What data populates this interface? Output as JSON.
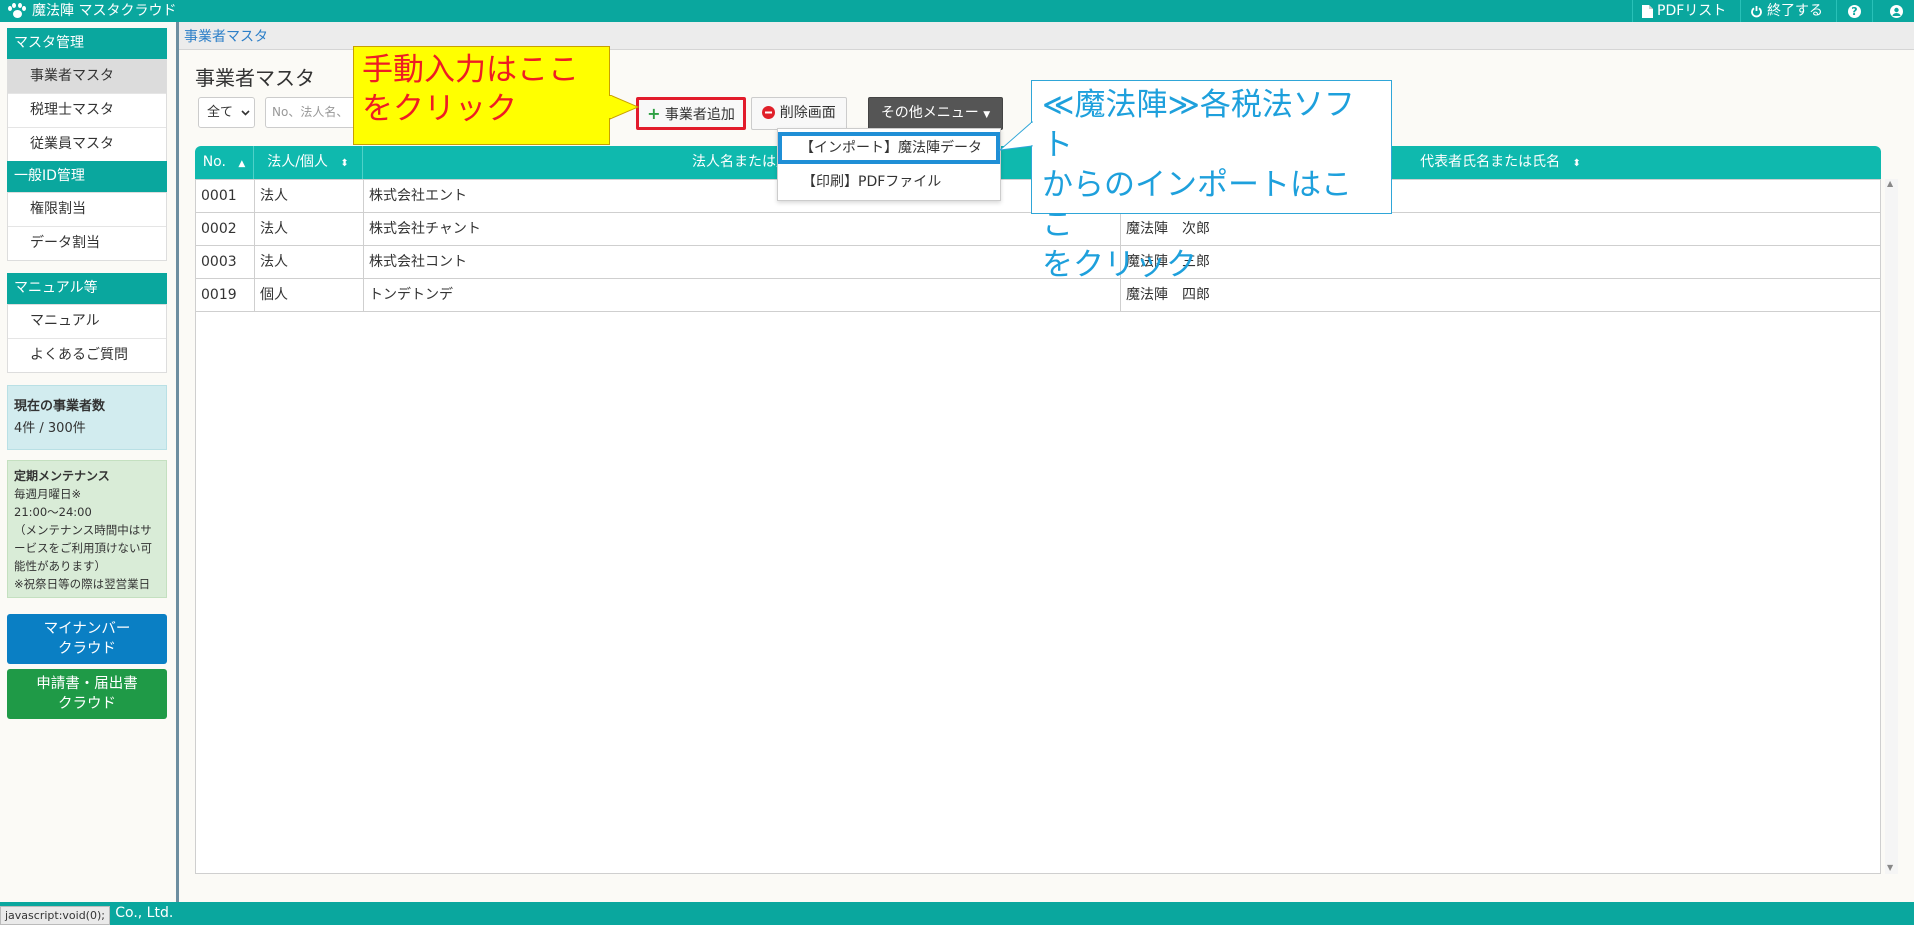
{
  "topbar": {
    "app_title": "魔法陣 マスタクラウド",
    "pdf_list": "PDFリスト",
    "logout": "終了する",
    "help_glyph": "?",
    "icons": [
      "paw-icon",
      "pdf-icon",
      "power-icon",
      "help-icon",
      "user-icon"
    ]
  },
  "sidebar": {
    "master_header": "マスタ管理",
    "master_items": [
      "事業者マスタ",
      "税理士マスタ",
      "従業員マスタ"
    ],
    "id_header": "一般ID管理",
    "id_items": [
      "権限割当",
      "データ割当"
    ],
    "manual_header": "マニュアル等",
    "manual_items": [
      "マニュアル",
      "よくあるご質問"
    ],
    "count_title": "現在の事業者数",
    "count_value": "4件 / 300件",
    "maint_title": "定期メンテナンス",
    "maint_lines": [
      "毎週月曜日※",
      "21:00〜24:00",
      "（メンテナンス時間中はサ",
      "ービスをご利用頂けない可",
      "能性があります）",
      "※祝祭日等の際は翌営業日"
    ],
    "mynumber_line1": "マイナンバー",
    "mynumber_line2": "クラウド",
    "shinsei_line1": "申請書・届出書",
    "shinsei_line2": "クラウド"
  },
  "breadcrumb": "事業者マスタ",
  "page_title": "事業者マスタ",
  "toolbar": {
    "filter_value": "全て",
    "search_placeholder": "No、法人名、",
    "add_label": "事業者追加",
    "delete_label": "削除画面",
    "other_menu_label": "その他メニュー"
  },
  "dropdown": {
    "import_label": "【インポート】魔法陣データ",
    "print_label": "【印刷】PDFファイル"
  },
  "table": {
    "headers": [
      "No.",
      "法人/個人",
      "法人名または屋",
      "代表者氏名または氏名"
    ],
    "rows": [
      {
        "no": "0001",
        "type": "法人",
        "name": "株式会社エント",
        "rep": ""
      },
      {
        "no": "0002",
        "type": "法人",
        "name": "株式会社チャント",
        "rep": "魔法陣　次郎"
      },
      {
        "no": "0003",
        "type": "法人",
        "name": "株式会社コント",
        "rep": "魔法陣　三郎"
      },
      {
        "no": "0019",
        "type": "個人",
        "name": "トンデトンデ",
        "rep": "魔法陣　四郎"
      }
    ]
  },
  "callouts": {
    "yellow_line1": "手動入力はここ",
    "yellow_line2": "をクリック",
    "blue_line1": "≪魔法陣≫各税法ソフト",
    "blue_line2": "からのインポートはここ",
    "blue_line3": "をクリック"
  },
  "footer": {
    "copyright_fragment": "D Co., Ltd.",
    "status_tip": "javascript:void(0);"
  },
  "colors": {
    "teal": "#0aa79e",
    "table_header": "#0fb9ae",
    "highlight_red": "#e21b2b",
    "highlight_blue": "#1f8fd6",
    "mynumber_blue": "#0a7fc4",
    "shinsei_green": "#1f9a47"
  }
}
